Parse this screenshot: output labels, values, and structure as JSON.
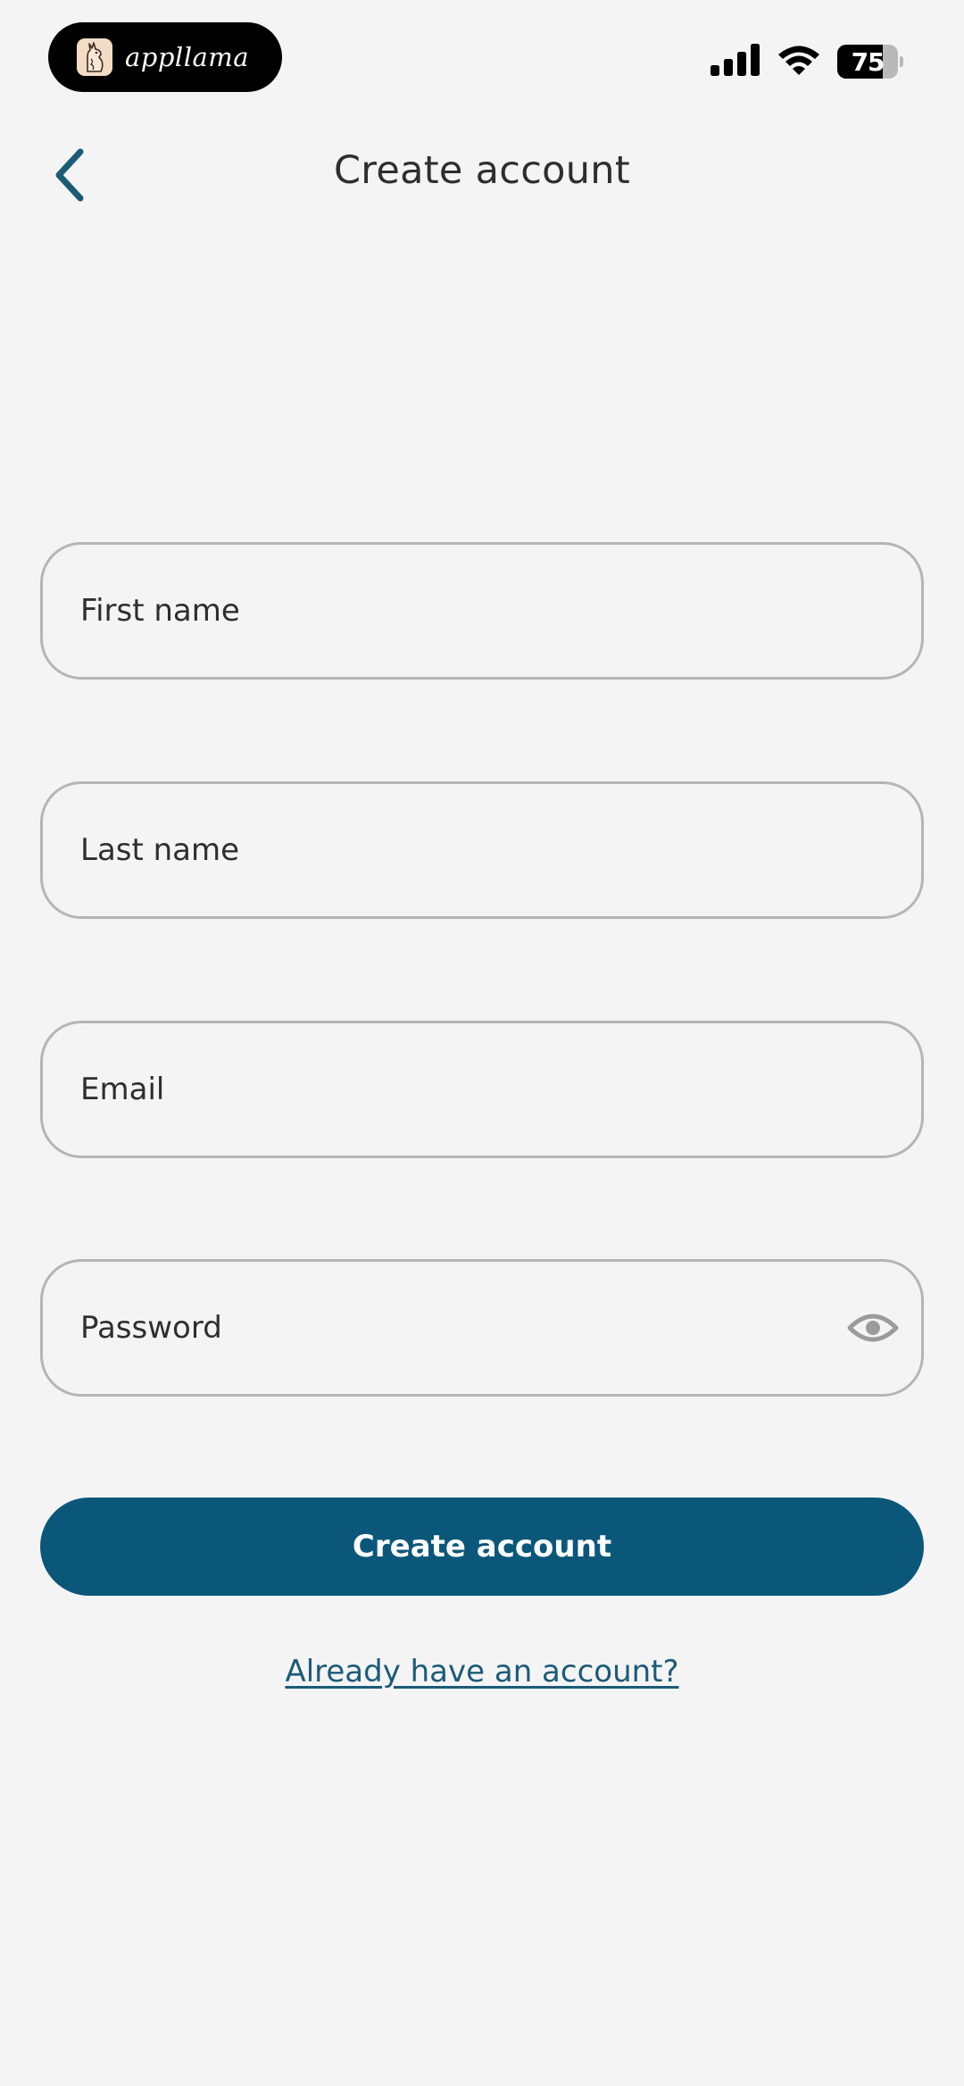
{
  "status_bar": {
    "app_name": "appllama",
    "battery_level": "75",
    "icons": [
      "cellular-signal-icon",
      "wifi-icon",
      "battery-icon"
    ]
  },
  "header": {
    "title": "Create account",
    "back_icon": "chevron-left-icon"
  },
  "form": {
    "first_name_placeholder": "First name",
    "last_name_placeholder": "Last name",
    "email_placeholder": "Email",
    "password_placeholder": "Password",
    "password_toggle_icon": "eye-icon",
    "submit_label": "Create account",
    "signin_link": "Already have an account?"
  },
  "colors": {
    "background": "#f4f4f4",
    "primary": "#0b577a",
    "link": "#1b5b78",
    "text": "#2e2e2e",
    "field_border": "#b5b5b5"
  }
}
